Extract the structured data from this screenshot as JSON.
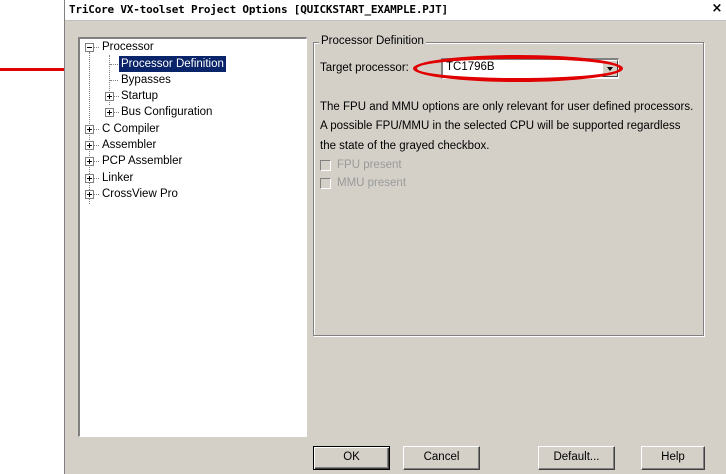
{
  "window": {
    "title": "TriCore VX-toolset Project Options [QUICKSTART_EXAMPLE.PJT]",
    "close_glyph": "×"
  },
  "tree": {
    "items": [
      {
        "label": "Processor",
        "expander": "minus"
      },
      {
        "label": "Processor Definition",
        "selected": true
      },
      {
        "label": "Bypasses"
      },
      {
        "label": "Startup",
        "expander": "plus"
      },
      {
        "label": "Bus Configuration",
        "expander": "plus"
      },
      {
        "label": "C Compiler",
        "expander": "plus"
      },
      {
        "label": "Assembler",
        "expander": "plus"
      },
      {
        "label": "PCP Assembler",
        "expander": "plus"
      },
      {
        "label": "Linker",
        "expander": "plus"
      },
      {
        "label": "CrossView Pro",
        "expander": "plus"
      }
    ]
  },
  "panel": {
    "group_title": "Processor Definition",
    "target_label": "Target processor:",
    "target_value": "TC1796B",
    "info_lines": [
      "The FPU and MMU options are only relevant for user defined processors.",
      "A possible FPU/MMU in the selected CPU will be supported regardless",
      "the state of the grayed checkbox."
    ],
    "checkboxes": [
      {
        "label": "FPU present",
        "checked": false,
        "enabled": false
      },
      {
        "label": "MMU present",
        "checked": false,
        "enabled": false
      }
    ]
  },
  "buttons": {
    "ok": "OK",
    "cancel": "Cancel",
    "default": "Default...",
    "help": "Help"
  },
  "annotation_color": "#e00000",
  "selection_color": "#0a246a"
}
